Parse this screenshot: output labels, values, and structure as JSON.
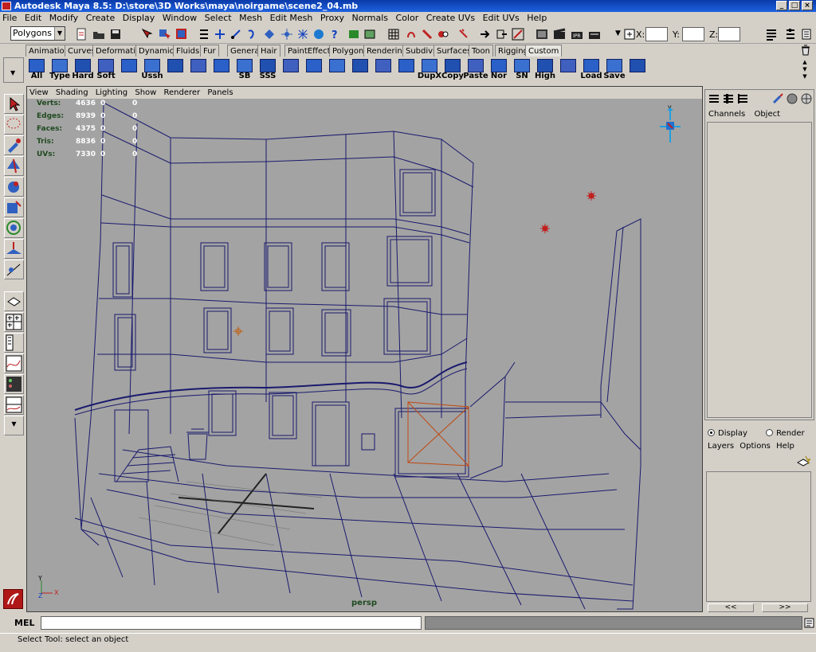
{
  "window": {
    "title": "Autodesk Maya 8.5: D:\\store\\3D Works\\maya\\noirgame\\scene2_04.mb"
  },
  "menu": [
    "File",
    "Edit",
    "Modify",
    "Create",
    "Display",
    "Window",
    "Select",
    "Mesh",
    "Edit Mesh",
    "Proxy",
    "Normals",
    "Color",
    "Create UVs",
    "Edit UVs",
    "Help"
  ],
  "statusline": {
    "menuset": "Polygons",
    "x_label": "X:",
    "y_label": "Y:",
    "z_label": "Z:"
  },
  "shelf_tabs": [
    "Animation",
    "Curves",
    "Deformation",
    "Dynamics",
    "Fluids",
    "Fur",
    "General",
    "Hair",
    "PaintEffects",
    "Polygons",
    "Rendering",
    "Subdivs",
    "Surfaces",
    "Toon",
    "Rigging",
    "Custom"
  ],
  "active_shelf_tab": "Custom",
  "shelf_buttons": [
    "All",
    "Type",
    "Hard",
    "Soft",
    "",
    "Ussh",
    "",
    "",
    "",
    "SB",
    "SSS",
    "",
    "",
    "",
    "",
    "",
    "",
    "DupX",
    "Copy",
    "Paste",
    "Nor",
    "SN",
    "High",
    "",
    "Load",
    "Save",
    ""
  ],
  "viewport": {
    "menu": [
      "View",
      "Shading",
      "Lighting",
      "Show",
      "Renderer",
      "Panels"
    ],
    "hud": [
      {
        "label": "Verts:",
        "values": [
          "4636",
          "0",
          "0"
        ]
      },
      {
        "label": "Edges:",
        "values": [
          "8939",
          "0",
          "0"
        ]
      },
      {
        "label": "Faces:",
        "values": [
          "4375",
          "0",
          "0"
        ]
      },
      {
        "label": "Tris:",
        "values": [
          "8836",
          "0",
          "0"
        ]
      },
      {
        "label": "UVs:",
        "values": [
          "7330",
          "0",
          "0"
        ]
      }
    ],
    "camera": "persp",
    "wire_color": "#1a1a6e",
    "bg_color": "#a3a3a3"
  },
  "channel_box": {
    "tabs": [
      "Channels",
      "Object"
    ]
  },
  "layer_editor": {
    "modes": [
      "Display",
      "Render"
    ],
    "menu": [
      "Layers",
      "Options",
      "Help"
    ],
    "nav": [
      "<<",
      ">>"
    ]
  },
  "command_line": {
    "label": "MEL"
  },
  "help_line": {
    "text": "Select Tool: select an object"
  }
}
